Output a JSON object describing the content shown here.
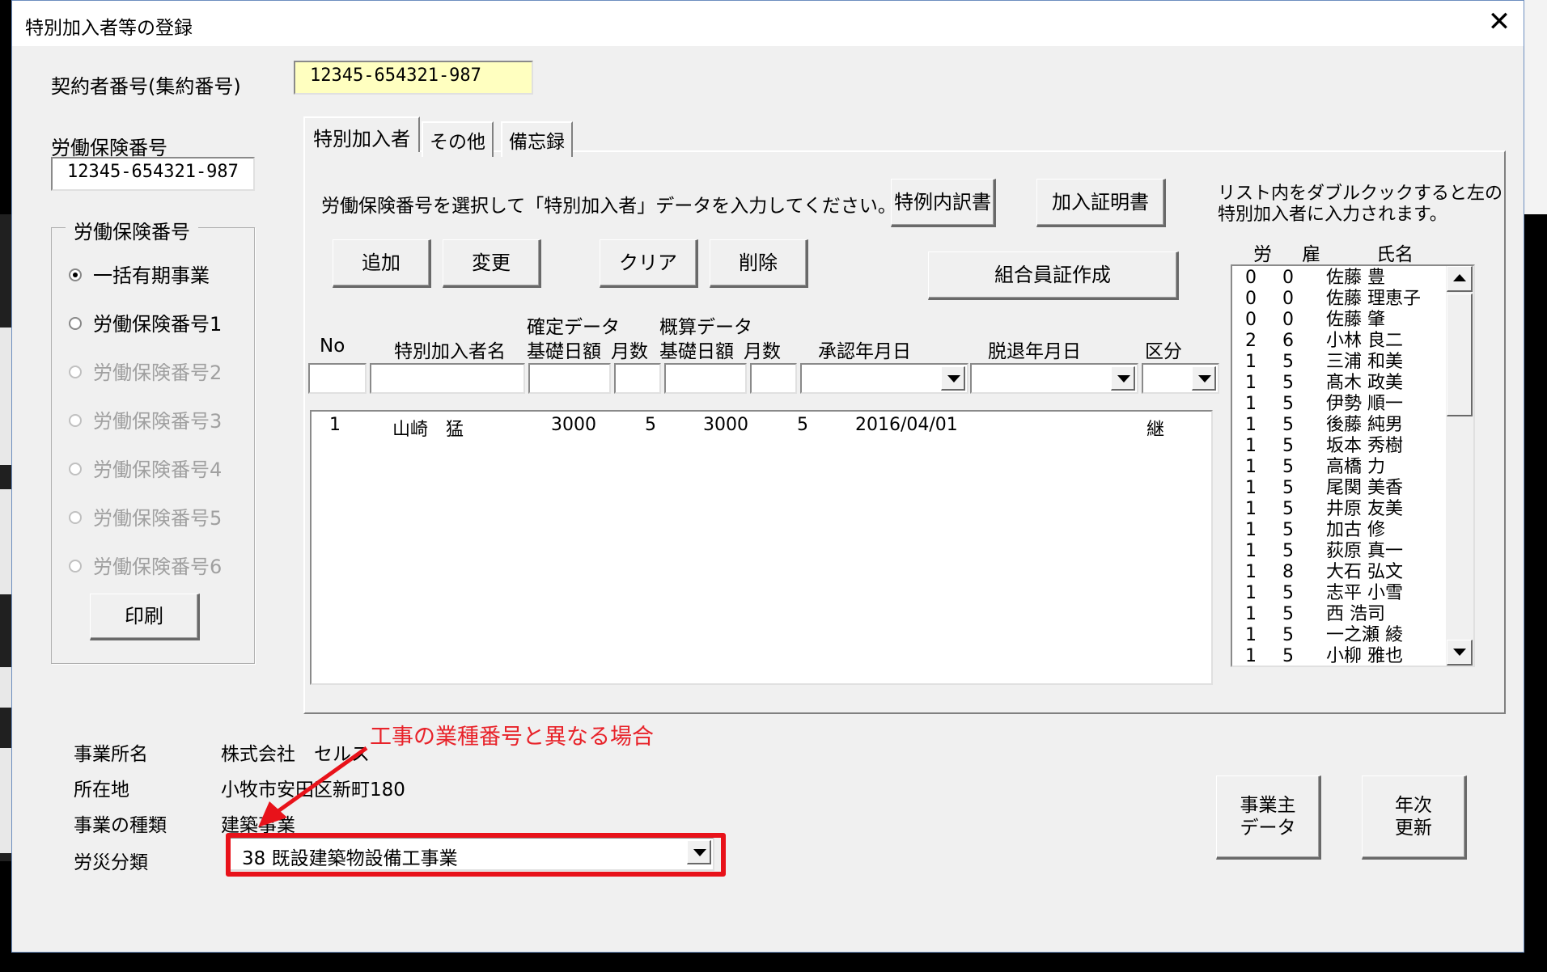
{
  "window": {
    "title": "特別加入者等の登録",
    "close_symbol": "✕"
  },
  "header": {
    "contractor_label": "契約者番号(集約番号)",
    "contractor_value": "12345-654321-987",
    "labor_ins_label": "労働保険番号",
    "labor_ins_value": "12345-654321-987"
  },
  "group": {
    "title": "労働保険番号",
    "options": [
      {
        "label": "一括有期事業",
        "checked": true,
        "enabled": true
      },
      {
        "label": "労働保険番号1",
        "checked": false,
        "enabled": true
      },
      {
        "label": "労働保険番号2",
        "checked": false,
        "enabled": false
      },
      {
        "label": "労働保険番号3",
        "checked": false,
        "enabled": false
      },
      {
        "label": "労働保険番号4",
        "checked": false,
        "enabled": false
      },
      {
        "label": "労働保険番号5",
        "checked": false,
        "enabled": false
      },
      {
        "label": "労働保険番号6",
        "checked": false,
        "enabled": false
      }
    ],
    "print_button": "印刷"
  },
  "tabs": [
    "特別加入者",
    "その他",
    "備忘録"
  ],
  "tab_main": {
    "instruction": "労働保険番号を選択して「特別加入者」データを入力してください。",
    "btn_special": "特例内訳書",
    "btn_certificate": "加入証明書",
    "btn_add": "追加",
    "btn_change": "変更",
    "btn_clear": "クリア",
    "btn_delete": "削除",
    "btn_union_card": "組合員証作成",
    "col_headers": {
      "no": "No",
      "name": "特別加入者名",
      "confirmed_group": "確定データ",
      "estimate_group": "概算データ",
      "daily1": "基礎日額",
      "months1": "月数",
      "daily2": "基礎日額",
      "months2": "月数",
      "approval": "承認年月日",
      "withdrawal": "脱退年月日",
      "category": "区分"
    },
    "rows": [
      {
        "no": "1",
        "name": "山崎　猛",
        "daily1": "3000",
        "months1": "5",
        "daily2": "3000",
        "months2": "5",
        "approval": "2016/04/01",
        "withdrawal": "",
        "category": "継"
      }
    ]
  },
  "roster": {
    "hint_line1": "リスト内をダブルクックすると左の",
    "hint_line2": "特別加入者に入力されます。",
    "headers": {
      "ro": "労",
      "ko": "雇",
      "name": "氏名"
    },
    "rows": [
      {
        "ro": "0",
        "ko": "0",
        "name": "佐藤 豊"
      },
      {
        "ro": "0",
        "ko": "0",
        "name": "佐藤 理恵子"
      },
      {
        "ro": "0",
        "ko": "0",
        "name": "佐藤 肇"
      },
      {
        "ro": "2",
        "ko": "6",
        "name": "小林 良二"
      },
      {
        "ro": "1",
        "ko": "5",
        "name": "三浦 和美"
      },
      {
        "ro": "1",
        "ko": "5",
        "name": "髙木 政美"
      },
      {
        "ro": "1",
        "ko": "5",
        "name": "伊勢 順一"
      },
      {
        "ro": "1",
        "ko": "5",
        "name": "後藤 純男"
      },
      {
        "ro": "1",
        "ko": "5",
        "name": "坂本 秀樹"
      },
      {
        "ro": "1",
        "ko": "5",
        "name": "高橋 力"
      },
      {
        "ro": "1",
        "ko": "5",
        "name": "尾関 美香"
      },
      {
        "ro": "1",
        "ko": "5",
        "name": "井原 友美"
      },
      {
        "ro": "1",
        "ko": "5",
        "name": "加古 修"
      },
      {
        "ro": "1",
        "ko": "5",
        "name": "荻原 真一"
      },
      {
        "ro": "1",
        "ko": "8",
        "name": "大石 弘文"
      },
      {
        "ro": "1",
        "ko": "5",
        "name": "志平 小雪"
      },
      {
        "ro": "1",
        "ko": "5",
        "name": "西 浩司"
      },
      {
        "ro": "1",
        "ko": "5",
        "name": "一之瀬 綾"
      },
      {
        "ro": "1",
        "ko": "5",
        "name": "小柳 雅也"
      }
    ]
  },
  "business": {
    "office_label": "事業所名",
    "office_value": "株式会社　セルス",
    "address_label": "所在地",
    "address_value": "小牧市安田区新町180",
    "type_label": "事業の種類",
    "type_value": "建築事業",
    "accident_label": "労災分類",
    "accident_value": "38 既設建築物設備工事業"
  },
  "side_buttons": {
    "employer_line1": "事業主",
    "employer_line2": "データ",
    "annual_line1": "年次",
    "annual_line2": "更新"
  },
  "annotation": {
    "text": "工事の業種番号と異なる場合",
    "color": "#e8232a"
  }
}
